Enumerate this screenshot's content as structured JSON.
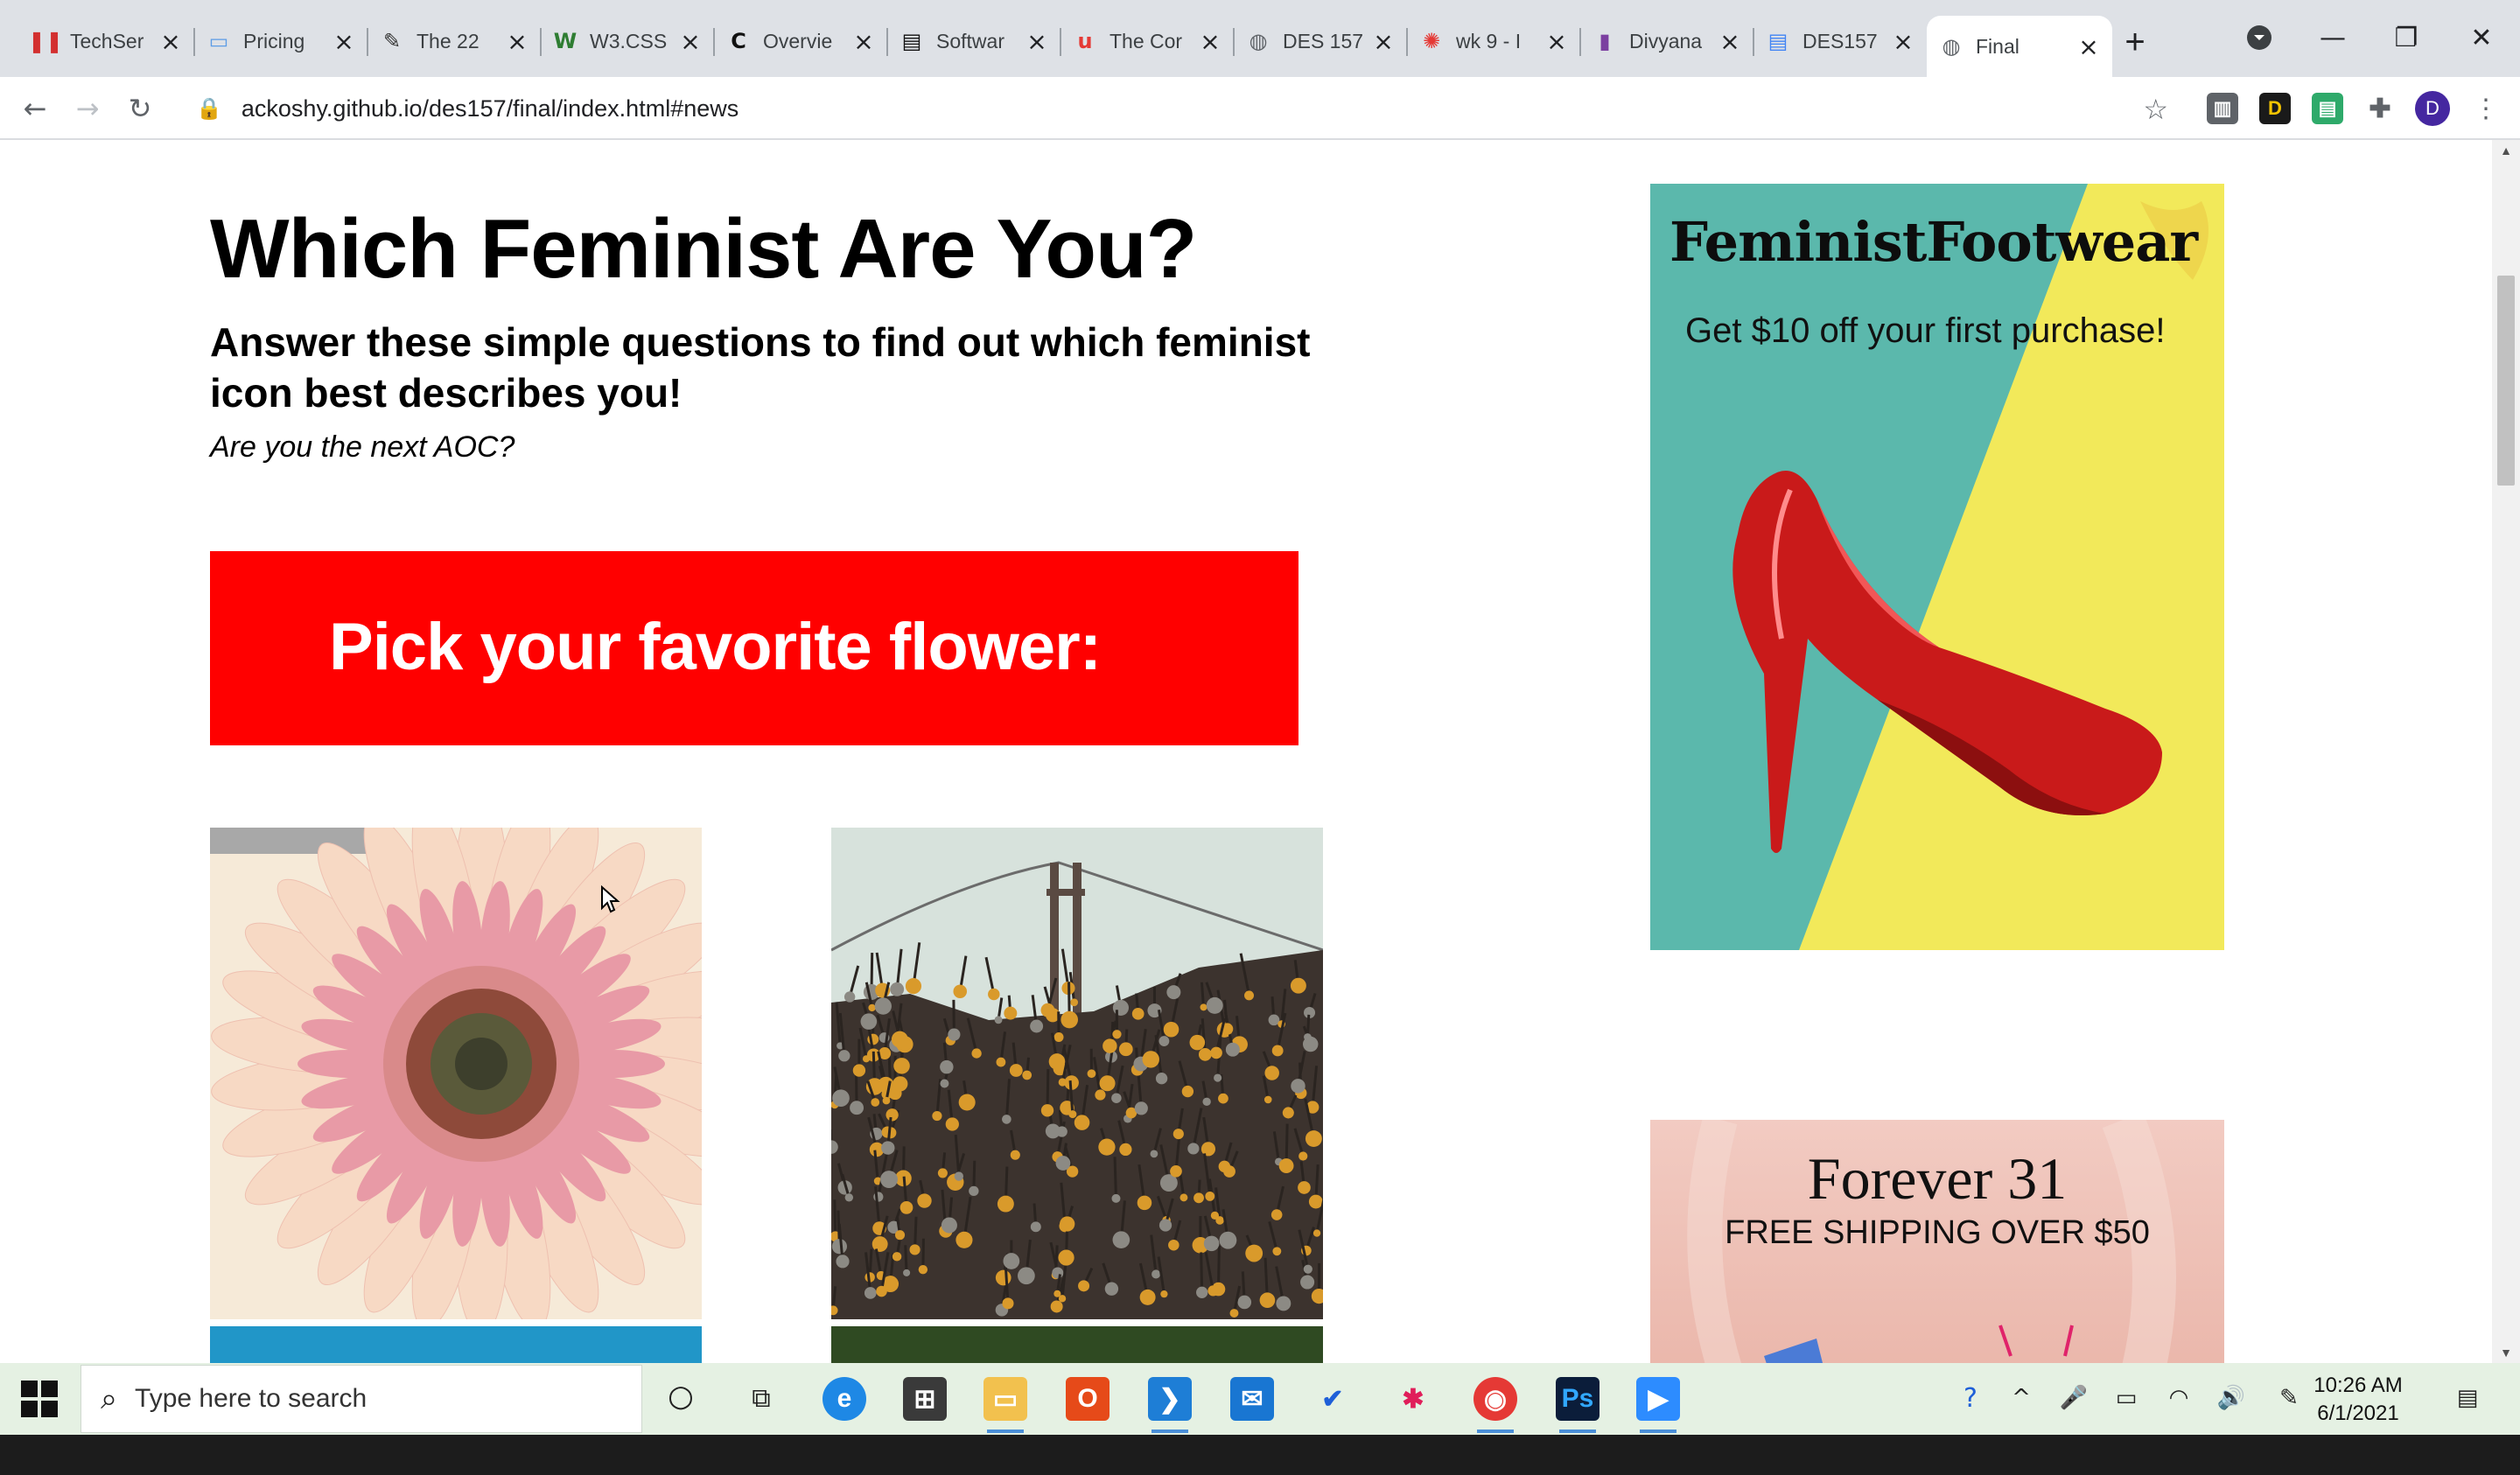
{
  "browser": {
    "tabs": [
      {
        "title": "TechSer",
        "icon": "techsmith-icon",
        "color": "#d32f2f",
        "glyph": "❚❚"
      },
      {
        "title": "Pricing",
        "icon": "pricing-icon",
        "color": "#5c9ce6",
        "glyph": "▭"
      },
      {
        "title": "The 22",
        "icon": "feather-icon",
        "color": "#333333",
        "glyph": "✎"
      },
      {
        "title": "W3.CSS",
        "icon": "w3schools-icon",
        "color": "#2e7d32",
        "glyph": "W"
      },
      {
        "title": "Overvie",
        "icon": "codecademy-icon",
        "color": "#111111",
        "glyph": "C"
      },
      {
        "title": "Softwar",
        "icon": "document-icon",
        "color": "#111111",
        "glyph": "▤"
      },
      {
        "title": "The Cor",
        "icon": "udemy-icon",
        "color": "#e53935",
        "glyph": "u"
      },
      {
        "title": "DES 157",
        "icon": "globe-icon",
        "color": "#5f6368",
        "glyph": "◍"
      },
      {
        "title": "wk 9 - I",
        "icon": "canvas-icon",
        "color": "#e53935",
        "glyph": "✺"
      },
      {
        "title": "Divyana",
        "icon": "notebook-icon",
        "color": "#7b3fa0",
        "glyph": "▮"
      },
      {
        "title": "DES157",
        "icon": "google-docs-icon",
        "color": "#4285f4",
        "glyph": "▤"
      },
      {
        "title": "Final",
        "icon": "globe-icon",
        "color": "#5f6368",
        "glyph": "◍",
        "active": true
      }
    ],
    "new_tab": "+",
    "url": "ackoshy.github.io/des157/final/index.html#news",
    "profile_initial": "D"
  },
  "page": {
    "title": "Which Feminist Are You?",
    "subtitle": "Answer these simple questions to find out which feminist icon best describes you!",
    "tagline": "Are you the next AOC?",
    "question": "Pick your favorite flower:",
    "question_bg": "#ff0000",
    "options": [
      {
        "name": "pink gerbera daisy"
      },
      {
        "name": "orange wildflowers with golden gate bridge"
      }
    ]
  },
  "ads": {
    "footwear": {
      "brand": "FeministFootwear",
      "offer": "Get $10 off your first purchase!",
      "colors": {
        "teal": "#5bb8ac",
        "yellow": "#f2e95a",
        "shoe": "#c91a1a"
      }
    },
    "forever": {
      "brand": "Forever 31",
      "promo": "FREE SHIPPING OVER $50"
    }
  },
  "taskbar": {
    "search_placeholder": "Type here to search",
    "time": "10:26 AM",
    "date": "6/1/2021"
  }
}
